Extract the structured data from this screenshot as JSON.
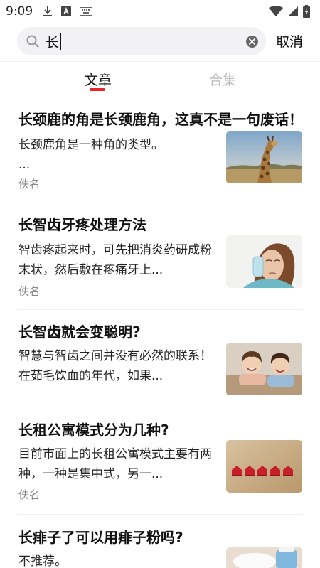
{
  "status_bar": {
    "time": "9:09",
    "icons_left": [
      "download-icon",
      "font-app-icon",
      "keyboard-icon"
    ],
    "icons_right": [
      "wifi-icon",
      "signal-icon",
      "battery-charging-icon"
    ]
  },
  "search": {
    "value": "长",
    "cancel_label": "取消"
  },
  "tabs": [
    {
      "label": "文章",
      "active": true
    },
    {
      "label": "合集",
      "active": false
    }
  ],
  "colors": {
    "accent": "#e8262a",
    "inactive_tab": "#b8b8b8",
    "author": "#888888"
  },
  "articles": [
    {
      "title": "长颈鹿的角是长颈鹿角，这真不是一句废话！",
      "summary_lines": [
        "长颈鹿角是一种角的类型。",
        "..."
      ],
      "author": "佚名",
      "thumbnail": "giraffe-photo"
    },
    {
      "title": "长智齿牙疼处理方法",
      "summary_lines": [
        "智齿疼起来时，可先把消炎药研成粉",
        "末状，然后敷在疼痛牙上..."
      ],
      "author": "佚名",
      "thumbnail": "toothache-woman-photo"
    },
    {
      "title": "长智齿就会变聪明?",
      "summary_lines": [
        "智慧与智齿之间并没有必然的联系！",
        "在茹毛饮血的年代，如果..."
      ],
      "author": "",
      "thumbnail": "smiling-children-photo"
    },
    {
      "title": "长租公寓模式分为几种?",
      "summary_lines": [
        "目前市面上的长租公寓模式主要有两",
        "种，一种是集中式，另一..."
      ],
      "author": "佚名",
      "thumbnail": "red-houses-photo"
    },
    {
      "title": "长痱子了可以用痱子粉吗?",
      "summary_lines": [
        "不推荐。"
      ],
      "author": "",
      "thumbnail": "baby-powder-photo"
    }
  ]
}
